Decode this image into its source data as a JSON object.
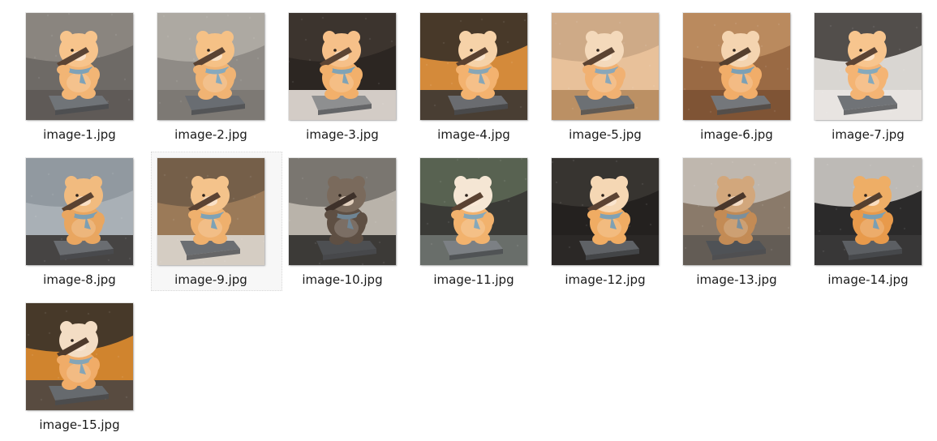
{
  "files": [
    {
      "name": "image-1.jpg",
      "selected": false,
      "bg": "#6e6a66",
      "bg2": "#8f8a84",
      "floor": "#5d5955",
      "bear": "#f2b575",
      "head": "#f7c48c",
      "base": "#707478",
      "scarf": "#7ea2b8",
      "arm": "#5b4434"
    },
    {
      "name": "image-2.jpg",
      "selected": false,
      "bg": "#8f8b86",
      "bg2": "#b3aea7",
      "floor": "#7b7772",
      "bear": "#f0b373",
      "head": "#f5c186",
      "base": "#696d72",
      "scarf": "#86a9bd",
      "arm": "#5a4333"
    },
    {
      "name": "image-3.jpg",
      "selected": false,
      "bg": "#2c2622",
      "bg2": "#403730",
      "floor": "#e6dfd8",
      "bear": "#f2b06b",
      "head": "#f6c089",
      "base": "#8e8f90",
      "scarf": "#7fa3b6",
      "arm": "#5d4534"
    },
    {
      "name": "image-4.jpg",
      "selected": false,
      "bg": "#d48a3a",
      "bg2": "#2f2a27",
      "floor": "#3a3533",
      "bear": "#f3b26f",
      "head": "#f6d2a8",
      "base": "#6a6c70",
      "scarf": "#87a6b6",
      "arm": "#5a4130"
    },
    {
      "name": "image-5.jpg",
      "selected": false,
      "bg": "#e8c19a",
      "bg2": "#c9a684",
      "floor": "#b68b5e",
      "bear": "#f1b172",
      "head": "#f4d9bb",
      "base": "#6c7074",
      "scarf": "#8aa7b9",
      "arm": "#5b4332"
    },
    {
      "name": "image-6.jpg",
      "selected": false,
      "bg": "#9a6a44",
      "bg2": "#c08f63",
      "floor": "#7c5234",
      "bear": "#f1ad69",
      "head": "#f4d4b0",
      "base": "#74777b",
      "scarf": "#7ca0b5",
      "arm": "#56402f"
    },
    {
      "name": "image-7.jpg",
      "selected": false,
      "bg": "#d9d6d2",
      "bg2": "#3a3634",
      "floor": "#e9e6e2",
      "bear": "#f4b474",
      "head": "#f7c58e",
      "base": "#707377",
      "scarf": "#85a9bc",
      "arm": "#5c4434"
    },
    {
      "name": "image-8.jpg",
      "selected": false,
      "bg": "#a9b0b6",
      "bg2": "#8d959c",
      "floor": "#3b3836",
      "bear": "#e9a660",
      "head": "#f1bb7f",
      "base": "#6a6d71",
      "scarf": "#7d9fb3",
      "arm": "#5a4231"
    },
    {
      "name": "image-9.jpg",
      "selected": true,
      "bg": "#9b7a58",
      "bg2": "#6f5a46",
      "floor": "#dcd6cf",
      "bear": "#efb06d",
      "head": "#f4c38b",
      "base": "#6b6e72",
      "scarf": "#7ea2b6",
      "arm": "#5b4333"
    },
    {
      "name": "image-10.jpg",
      "selected": false,
      "bg": "#b9b3aa",
      "bg2": "#6e6b66",
      "floor": "#2f2c2a",
      "bear": "#5e4f43",
      "head": "#7a6a5c",
      "base": "#4d4f52",
      "scarf": "#6f8594",
      "arm": "#3e312a"
    },
    {
      "name": "image-11.jpg",
      "selected": false,
      "bg": "#3a3a36",
      "bg2": "#5e6a56",
      "floor": "#6f7470",
      "bear": "#f2b26d",
      "head": "#f5e6d4",
      "base": "#7c8084",
      "scarf": "#86a8ba",
      "arm": "#5a4232"
    },
    {
      "name": "image-12.jpg",
      "selected": false,
      "bg": "#24211f",
      "bg2": "#3b3734",
      "floor": "#2c2927",
      "bear": "#f0ac63",
      "head": "#f5d7b4",
      "base": "#5f6266",
      "scarf": "#7fa1b4",
      "arm": "#5b4333"
    },
    {
      "name": "image-13.jpg",
      "selected": false,
      "bg": "#8a7a6a",
      "bg2": "#c8c2ba",
      "floor": "#5e5953",
      "bear": "#c38b55",
      "head": "#d2a77c",
      "base": "#4f5256",
      "scarf": "#7b8f9c",
      "arm": "#4a372b"
    },
    {
      "name": "image-14.jpg",
      "selected": false,
      "bg": "#2b2a2a",
      "bg2": "#d7d3cf",
      "floor": "#3a3838",
      "bear": "#e89a4b",
      "head": "#eeae66",
      "base": "#5c5f63",
      "scarf": "#7a9fb3",
      "arm": "#55402f"
    },
    {
      "name": "image-15.jpg",
      "selected": false,
      "bg": "#d0842e",
      "bg2": "#2f2b28",
      "floor": "#4a4542",
      "bear": "#f0ac68",
      "head": "#f3ddc4",
      "base": "#666a6e",
      "scarf": "#84a5b7",
      "arm": "#4e3a2c"
    }
  ]
}
